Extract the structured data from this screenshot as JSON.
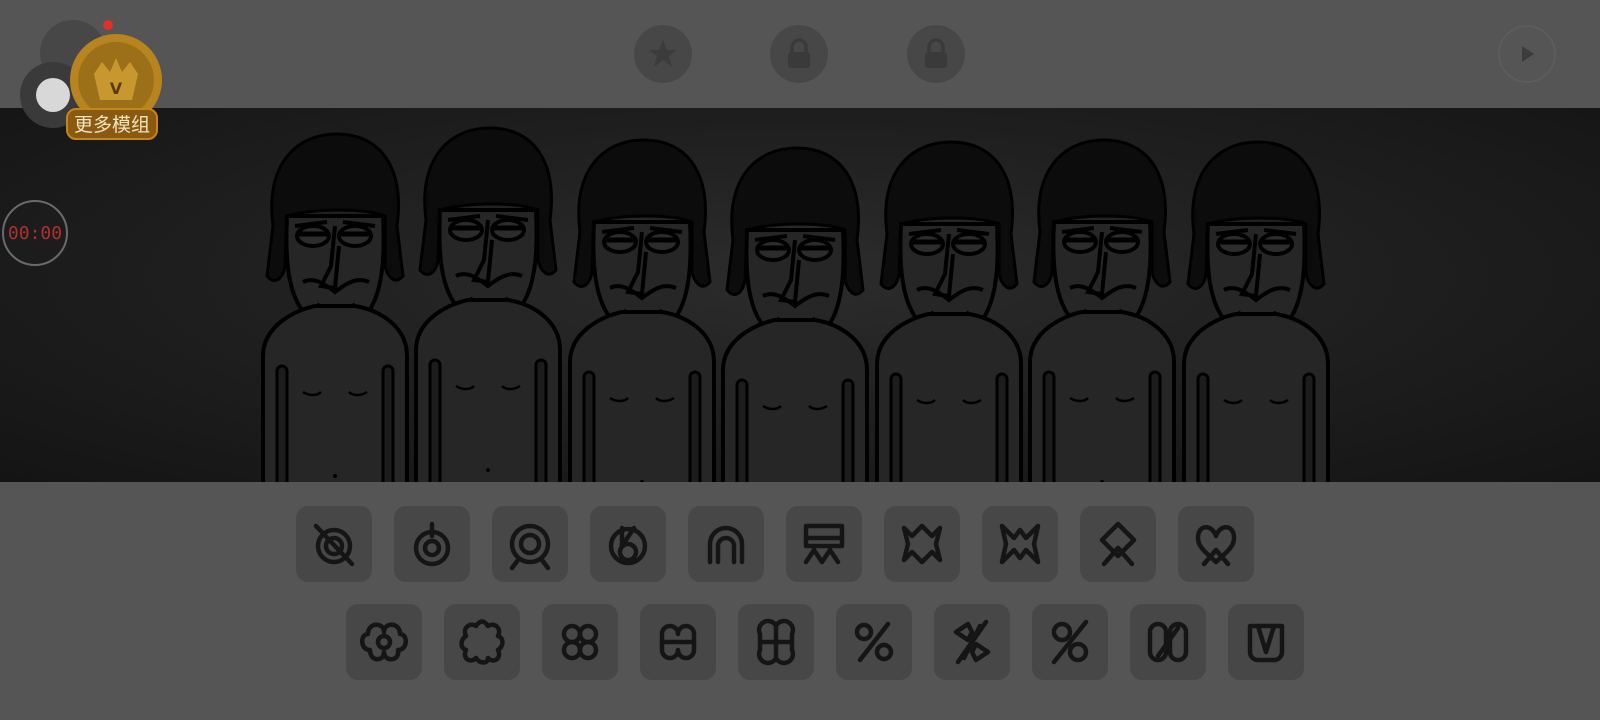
{
  "app": {
    "vip_badge_letter": "V",
    "vip_label": "更多模组",
    "timer": "00:00"
  },
  "toolbar": {
    "icons": [
      "bonus-star-icon",
      "lock-icon",
      "lock-icon",
      "play-icon"
    ]
  },
  "stage": {
    "characters_count_label": "",
    "characters": [
      "performer-1",
      "performer-2",
      "performer-3",
      "performer-4",
      "performer-5",
      "performer-6",
      "performer-7"
    ]
  },
  "sound_rows": [
    [
      "circle-slash-sound",
      "circle-drop-sound",
      "double-circle-sound",
      "circle-stem-sound",
      "arch-sound",
      "banner-zigzag-sound",
      "star-zigzag-sound",
      "notch-zigzag-sound",
      "diamond-sound",
      "double-leaf-sound"
    ],
    [
      "clover-1-sound",
      "clover-2-sound",
      "clover-3-sound",
      "clover-4-sound",
      "clover-5-sound",
      "percent-1-sound",
      "percent-2-sound",
      "percent-3-sound",
      "capsule-1-sound",
      "capsule-2-sound"
    ]
  ],
  "colors": {
    "background": "#555555",
    "stage": "#1e1e1e",
    "button": "#474747",
    "icon_stroke": "#151515",
    "timer_text": "#b03030",
    "vip_gold": "#c4861c"
  }
}
